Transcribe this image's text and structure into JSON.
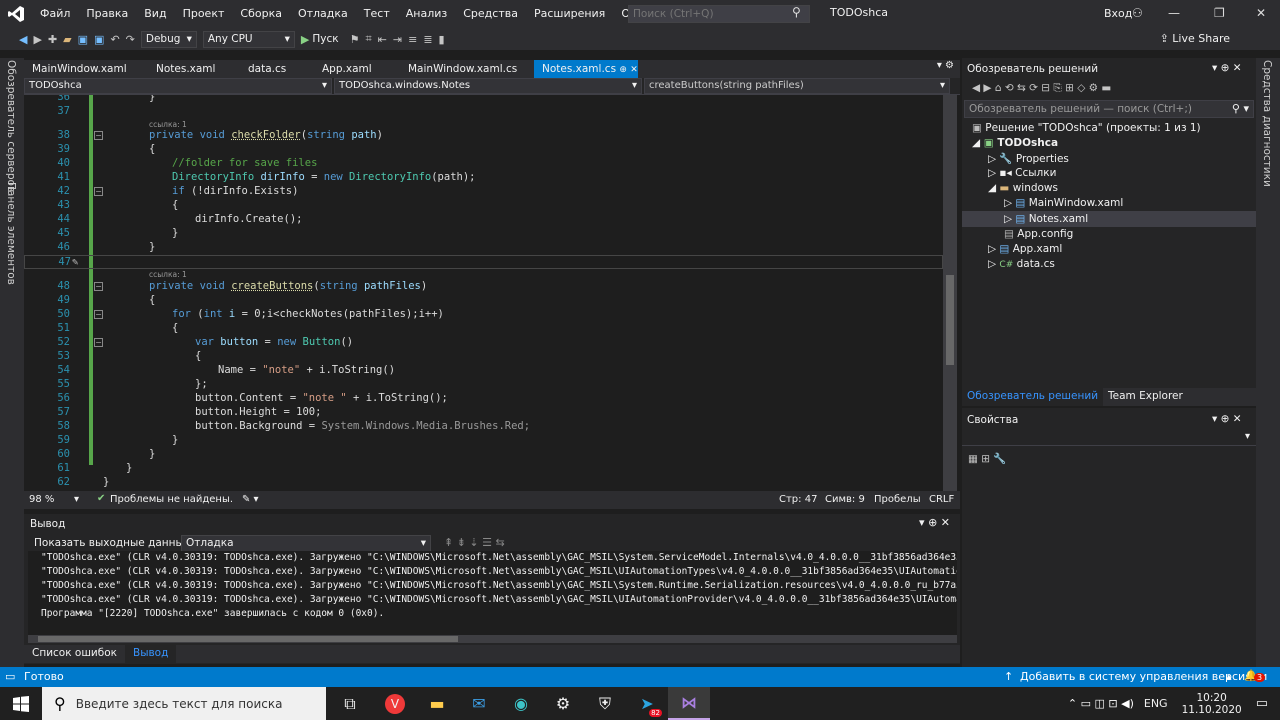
{
  "menu": {
    "items": [
      "Файл",
      "Правка",
      "Вид",
      "Проект",
      "Сборка",
      "Отладка",
      "Тест",
      "Анализ",
      "Средства",
      "Расширения",
      "Окно",
      "Справка"
    ],
    "search_placeholder": "Поиск (Ctrl+Q)",
    "solution_title": "TODOshca",
    "signin": "Вход"
  },
  "toolbar": {
    "config": "Debug",
    "platform": "Any CPU",
    "run_label": "Пуск",
    "live_share": "Live Share"
  },
  "left_strip": {
    "server_explorer": "Обозреватель серверов",
    "toolbox": "Панель элементов"
  },
  "right_strip": {
    "diagnostics": "Средства диагностики"
  },
  "tabs": [
    {
      "label": "MainWindow.xaml",
      "active": false
    },
    {
      "label": "Notes.xaml",
      "active": false
    },
    {
      "label": "data.cs",
      "active": false
    },
    {
      "label": "App.xaml",
      "active": false
    },
    {
      "label": "MainWindow.xaml.cs",
      "active": false
    },
    {
      "label": "Notes.xaml.cs",
      "active": true
    }
  ],
  "nav": {
    "project": "TODOshca",
    "class": "TODOshca.windows.Notes",
    "member": "createButtons(string pathFiles)"
  },
  "code": {
    "ref1": "ссылка: 1",
    "ref2": "ссылка: 1",
    "l36": "}",
    "l38a": "private void ",
    "l38b": "checkFolder",
    "l38c": "(",
    "l38d": "string ",
    "l38e": "path",
    "l38f": ")",
    "l39": "{",
    "l40": "//folder for save files",
    "l41a": "DirectoryInfo ",
    "l41b": "dirInfo",
    "l41c": " = ",
    "l41d": "new ",
    "l41e": "DirectoryInfo",
    "l41f": "(path);",
    "l42a": "if ",
    "l42b": "(!dirInfo.Exists)",
    "l43": "{",
    "l44": "dirInfo.Create();",
    "l45": "}",
    "l46": "}",
    "l48a": "private void ",
    "l48b": "createButtons",
    "l48c": "(",
    "l48d": "string ",
    "l48e": "pathFiles",
    "l48f": ")",
    "l49": "{",
    "l50a": "for ",
    "l50b": "(",
    "l50c": "int ",
    "l50d": "i",
    "l50e": " = 0;i<checkNotes(pathFiles);i++)",
    "l51": "{",
    "l52a": "var ",
    "l52b": "button",
    "l52c": " = ",
    "l52d": "new ",
    "l52e": "Button",
    "l52f": "()",
    "l53": "{",
    "l54a": "Name = ",
    "l54b": "\"note\"",
    "l54c": " + i.ToString()",
    "l55": "};",
    "l56a": "button.Content = ",
    "l56b": "\"note \"",
    "l56c": " + i.ToString();",
    "l57": "button.Height = 100;",
    "l58a": "button.Background = ",
    "l58b": "System.Windows.Media.Brushes.Red;",
    "l59": "}",
    "l60": "}",
    "l61": "}",
    "l62": "}"
  },
  "editor_status": {
    "zoom": "98 %",
    "problems": "Проблемы не найдены.",
    "line": "Стр: 47",
    "col": "Симв: 9",
    "spaces": "Пробелы",
    "eol": "CRLF"
  },
  "output": {
    "title": "Вывод",
    "show_from": "Показать выходные данные из:",
    "source": "Отладка",
    "lines": [
      "\"TODOshca.exe\" (CLR v4.0.30319: TODOshca.exe). Загружено \"C:\\WINDOWS\\Microsoft.Net\\assembly\\GAC_MSIL\\System.ServiceModel.Internals\\v4.0_4.0.0.0__31bf3856ad364e35\\System.S",
      "\"TODOshca.exe\" (CLR v4.0.30319: TODOshca.exe). Загружено \"C:\\WINDOWS\\Microsoft.Net\\assembly\\GAC_MSIL\\UIAutomationTypes\\v4.0_4.0.0.0__31bf3856ad364e35\\UIAutomationTypes.dl",
      "\"TODOshca.exe\" (CLR v4.0.30319: TODOshca.exe). Загружено \"C:\\WINDOWS\\Microsoft.Net\\assembly\\GAC_MSIL\\System.Runtime.Serialization.resources\\v4.0_4.0.0.0_ru_b77a5c561934e0",
      "\"TODOshca.exe\" (CLR v4.0.30319: TODOshca.exe). Загружено \"C:\\WINDOWS\\Microsoft.Net\\assembly\\GAC_MSIL\\UIAutomationProvider\\v4.0_4.0.0.0__31bf3856ad364e35\\UIAutomationProvi",
      "Программа \"[2220] TODOshca.exe\" завершилась с кодом 0 (0x0)."
    ]
  },
  "bottom_tabs": [
    "Список ошибок",
    "Вывод"
  ],
  "solution_explorer": {
    "title": "Обозреватель решений",
    "search_placeholder": "Обозреватель решений — поиск (Ctrl+;)",
    "solution": "Решение \"TODOshca\" (проекты: 1 из 1)",
    "project": "TODOshca",
    "properties": "Properties",
    "references": "Ссылки",
    "windows": "windows",
    "mainwindow": "MainWindow.xaml",
    "notes": "Notes.xaml",
    "appconfig": "App.config",
    "appxaml": "App.xaml",
    "datacs": "data.cs",
    "tab_se": "Обозреватель решений",
    "tab_te": "Team Explorer"
  },
  "properties": {
    "title": "Свойства"
  },
  "statusbar": {
    "ready": "Готово",
    "vcs": "Добавить в систему управления версиями",
    "badge": "3"
  },
  "taskbar": {
    "search": "Введите здесь текст для поиска",
    "lang": "ENG",
    "time": "10:20",
    "date": "11.10.2020",
    "badge": "82"
  },
  "colors": {
    "accent": "#007acc",
    "keyword": "#569cd6",
    "type": "#4ec9b0",
    "string": "#d69d85",
    "comment": "#57a64a"
  }
}
